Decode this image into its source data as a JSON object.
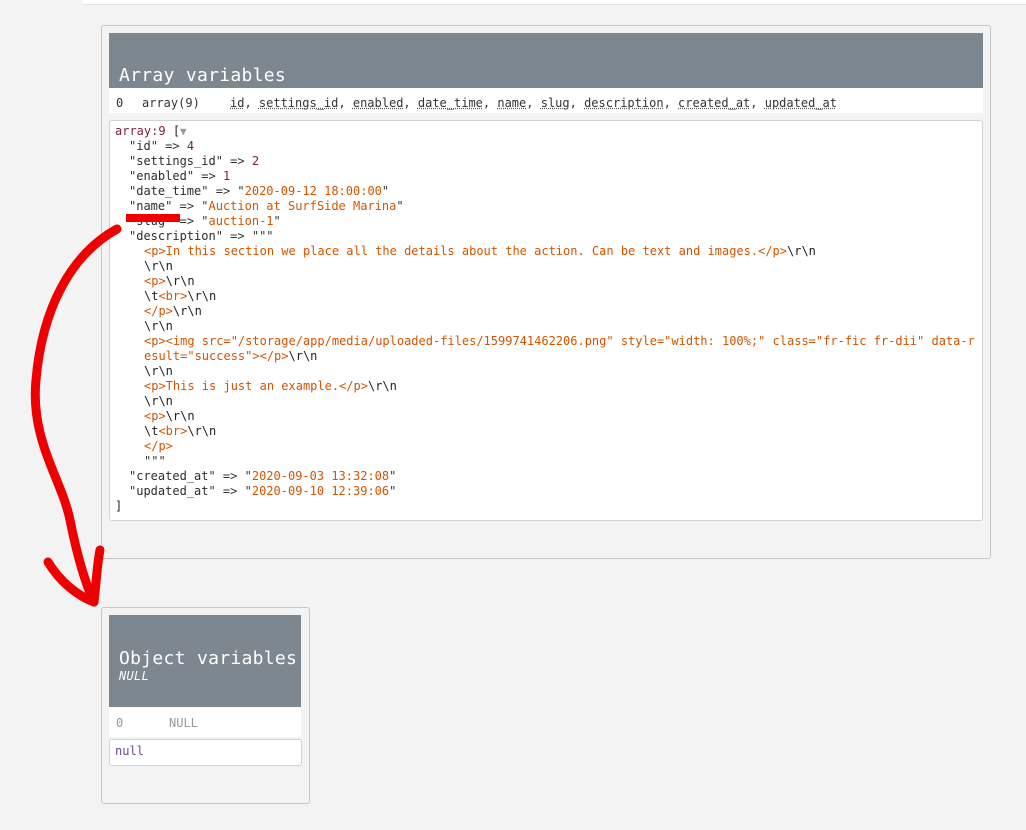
{
  "array_panel": {
    "title": "Array variables",
    "row": {
      "index": "0",
      "type": "array(9)",
      "keys": [
        "id",
        "settings_id",
        "enabled",
        "date_time",
        "name",
        "slug",
        "description",
        "created_at",
        "updated_at"
      ]
    },
    "dump": {
      "header": "array:9",
      "open_bracket": "[",
      "toggle_glyph": "▼",
      "close_bracket": "]",
      "arrow": "=>",
      "entries": [
        {
          "key": "id",
          "value": "4",
          "kind": "num"
        },
        {
          "key": "settings_id",
          "value": "2",
          "kind": "num"
        },
        {
          "key": "enabled",
          "value": "1",
          "kind": "num"
        },
        {
          "key": "date_time",
          "value": "2020-09-12 18:00:00",
          "kind": "str"
        },
        {
          "key": "name",
          "value": "Auction at SurfSide Marina",
          "kind": "str"
        },
        {
          "key": "slug",
          "value": "auction-1",
          "kind": "str"
        }
      ],
      "description_key": "description",
      "triple_quote": "\"\"\"",
      "description_lines": [
        "<p>In this section we place all the details about the action. Can be text and images.</p>\\r\\n",
        "\\r\\n",
        "<p>\\r\\n",
        "\\t<br>\\r\\n",
        "</p>\\r\\n",
        "\\r\\n",
        "<p><img src=\"/storage/app/media/uploaded-files/1599741462206.png\" style=\"width: 100%;\" class=\"fr-fic fr-dii\" data-r",
        "esult=\"success\"></p>\\r\\n",
        "\\r\\n",
        "<p>This is just an example.</p>\\r\\n",
        "\\r\\n",
        "<p>\\r\\n",
        "\\t<br>\\r\\n",
        "</p>"
      ],
      "tail_entries": [
        {
          "key": "created_at",
          "value": "2020-09-03 13:32:08",
          "kind": "str"
        },
        {
          "key": "updated_at",
          "value": "2020-09-10 12:39:06",
          "kind": "str"
        }
      ]
    }
  },
  "object_panel": {
    "title": "Object variables",
    "subtitle": "NULL",
    "row": {
      "index": "0",
      "type": "NULL"
    },
    "dump_value": "null"
  },
  "annotation_color": "#ee0000"
}
